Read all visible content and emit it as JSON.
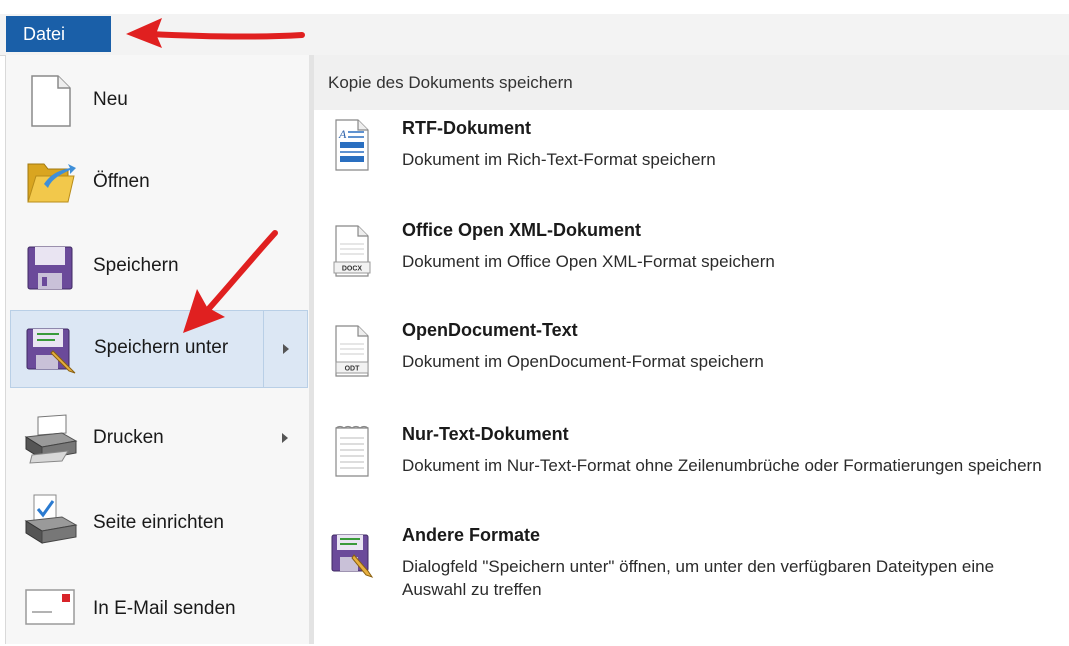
{
  "menu_bar": {
    "file_tab": "Datei"
  },
  "left_menu": {
    "items": [
      {
        "id": "new",
        "label": "Neu",
        "icon": "new-document-icon"
      },
      {
        "id": "open",
        "label": "Öffnen",
        "icon": "open-folder-icon"
      },
      {
        "id": "save",
        "label": "Speichern",
        "icon": "save-disk-icon"
      },
      {
        "id": "save-as",
        "label": "Speichern unter",
        "icon": "save-as-icon",
        "active": true,
        "submenu": true
      },
      {
        "id": "print",
        "label": "Drucken",
        "icon": "printer-icon",
        "submenu": true
      },
      {
        "id": "page-setup",
        "label": "Seite einrichten",
        "icon": "page-setup-icon"
      },
      {
        "id": "email",
        "label": "In E-Mail senden",
        "icon": "email-icon"
      }
    ]
  },
  "save_as_panel": {
    "heading": "Kopie des Dokuments speichern",
    "options": [
      {
        "title": "RTF-Dokument",
        "description": "Dokument im Rich-Text-Format speichern",
        "icon": "rtf-document-icon"
      },
      {
        "title": "Office Open XML-Dokument",
        "description": "Dokument im Office Open XML-Format speichern",
        "icon": "docx-document-icon",
        "icon_text": "DOCX"
      },
      {
        "title": "OpenDocument-Text",
        "description": "Dokument im OpenDocument-Format speichern",
        "icon": "odt-document-icon",
        "icon_text": "ODT"
      },
      {
        "title": "Nur-Text-Dokument",
        "description": "Dokument im Nur-Text-Format ohne Zeilenumbrüche oder Formatierungen speichern",
        "icon": "plain-text-document-icon"
      },
      {
        "title": "Andere Formate",
        "description": "Dialogfeld \"Speichern unter\" öffnen, um unter den verfügbaren Dateitypen eine Auswahl zu treffen",
        "icon": "save-as-icon"
      }
    ]
  },
  "annotations": {
    "arrow_color": "#e02020"
  }
}
